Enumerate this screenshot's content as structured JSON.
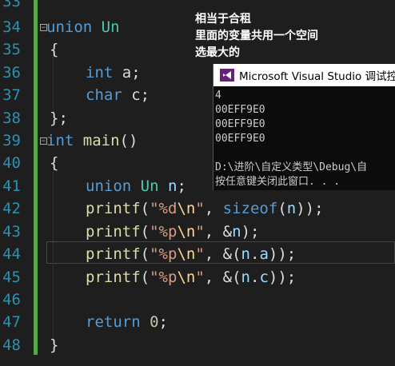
{
  "gutter": {
    "line_numbers": [
      "33",
      "34",
      "35",
      "36",
      "37",
      "38",
      "39",
      "40",
      "41",
      "42",
      "43",
      "44",
      "45",
      "46",
      "47",
      "48"
    ]
  },
  "code": {
    "l34": {
      "kw": "union",
      "name": "Un"
    },
    "l35": "{",
    "l36": {
      "type": "int",
      "rest": " a;"
    },
    "l37": {
      "type": "char",
      "rest": " c;"
    },
    "l38": "};",
    "l39": {
      "type": "int",
      "name": "main",
      "rest": "()"
    },
    "l40": "{",
    "l41": {
      "kw": "union",
      "name": "Un",
      "var": "n",
      "semi": ";"
    },
    "l42": {
      "fn": "printf",
      "open": "(",
      "q1": "\"",
      "fmt": "%d",
      "esc": "\\n",
      "q2": "\"",
      "comma": ", ",
      "kw": "sizeof",
      "p1": "(",
      "var": "n",
      "tail": "));"
    },
    "l43": {
      "fn": "printf",
      "open": "(",
      "q1": "\"",
      "fmt": "%p",
      "esc": "\\n",
      "q2": "\"",
      "comma": ", &",
      "var": "n",
      "tail": ");"
    },
    "l44": {
      "fn": "printf",
      "open": "(",
      "q1": "\"",
      "fmt": "%p",
      "esc": "\\n",
      "q2": "\"",
      "comma": ", &(",
      "var": "n",
      "dot": ".",
      "mem": "a",
      "tail": "));"
    },
    "l45": {
      "fn": "printf",
      "open": "(",
      "q1": "\"",
      "fmt": "%p",
      "esc": "\\n",
      "q2": "\"",
      "comma": ", &(",
      "var": "n",
      "dot": ".",
      "mem": "c",
      "tail": "));"
    },
    "l47": {
      "kw": "return",
      "num": "0",
      "semi": ";"
    },
    "l48": "}"
  },
  "annotation": {
    "line1": "相当于合租",
    "line2": "里面的变量共用一个空间",
    "line3": "选最大的"
  },
  "console": {
    "title": "Microsoft Visual Studio 调试控制",
    "icon": "vs-icon",
    "output": [
      "4",
      "00EFF9E0",
      "00EFF9E0",
      "00EFF9E0",
      "",
      "D:\\进阶\\自定义类型\\Debug\\自",
      "按任意键关闭此窗口. . ."
    ]
  },
  "colors": {
    "background": "#1e1e1e",
    "keyword": "#569cd6",
    "type": "#4ec9b0",
    "string": "#d69d85",
    "function": "#dcdcaa",
    "line_number": "#2b91af"
  }
}
